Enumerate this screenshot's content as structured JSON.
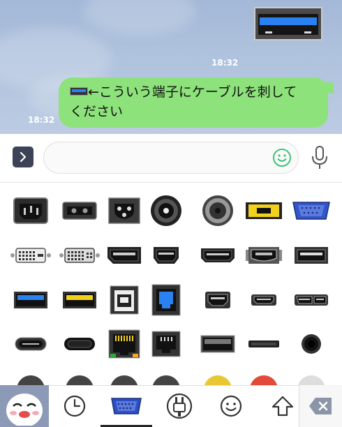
{
  "chat": {
    "image_time": "18:32",
    "message_text": "←こういう端子にケーブルを刺して",
    "message_text_line2": "ください",
    "message_time": "18:32"
  },
  "input": {
    "placeholder": "",
    "value": ""
  },
  "icons": {
    "expand": "chevron-right-icon",
    "emoji": "smiley-icon",
    "mic": "microphone-icon",
    "backspace": "backspace-icon"
  },
  "colors": {
    "chat_bg": "#abc0dc",
    "bubble": "#8de27b",
    "usb3_blue": "#2a82f0",
    "yellow": "#f2d01e",
    "vga_blue": "#3056c8",
    "emoji_green": "#3cc27b"
  },
  "sticker_rows": [
    [
      "c14-power-port",
      "c8-power-port",
      "c5-power-port",
      "round-port-dark",
      "round-port-grey",
      "yellow-slot-port",
      "vga-port"
    ],
    [
      "dvi-port",
      "dvi-port-2",
      "displayport-port",
      "mini-displayport-port",
      "hdmi-port",
      "firewire-port",
      "esata-port"
    ],
    [
      "usb-a-blue-port",
      "usb-a-yellow-port",
      "usb-b-port",
      "usb-b-blue-port",
      "mini-hdmi-port",
      "micro-hdmi-port",
      "micro-usb3-port"
    ],
    [
      "usb-c-port",
      "usb-c-port-2",
      "ethernet-port",
      "rj11-port",
      "usb-a-dark-port",
      "slim-slot-port",
      "audio-jack-port"
    ]
  ],
  "tabs": [
    {
      "name": "tab-profile-sticker",
      "icon": "character-face-icon"
    },
    {
      "name": "tab-recent",
      "icon": "clock-icon"
    },
    {
      "name": "tab-ports-stickers",
      "icon": "vga-connector-icon",
      "active": true
    },
    {
      "name": "tab-pack-2",
      "icon": "plug-face-icon"
    },
    {
      "name": "tab-emoji",
      "icon": "smiley-icon"
    },
    {
      "name": "tab-shift",
      "icon": "up-arrow-icon"
    },
    {
      "name": "tab-backspace",
      "icon": "backspace-icon"
    }
  ]
}
